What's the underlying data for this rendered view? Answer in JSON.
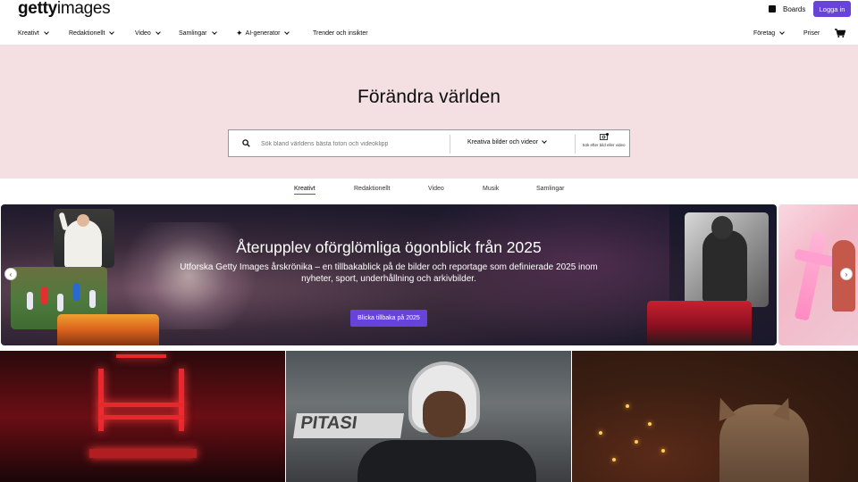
{
  "header": {
    "logo_bold": "getty",
    "logo_light": "images",
    "boards_label": "Boards",
    "login_label": "Logga in"
  },
  "nav": {
    "items": [
      {
        "label": "Kreativt"
      },
      {
        "label": "Redaktionellt"
      },
      {
        "label": "Video"
      },
      {
        "label": "Samlingar"
      },
      {
        "label": "AI-generator"
      },
      {
        "label": "Trender och insikter"
      }
    ],
    "right": [
      {
        "label": "Företag"
      },
      {
        "label": "Priser"
      }
    ]
  },
  "hero": {
    "title": "Förändra världen",
    "search_placeholder": "Sök bland världens bästa foton och videoklipp",
    "search_type": "Kreativa bilder och videor",
    "image_search_label": "Sök efter bild eller video"
  },
  "tabs": [
    {
      "label": "Kreativt",
      "active": true
    },
    {
      "label": "Redaktionellt",
      "active": false
    },
    {
      "label": "Video",
      "active": false
    },
    {
      "label": "Musik",
      "active": false
    },
    {
      "label": "Samlingar",
      "active": false
    }
  ],
  "banner": {
    "title": "Återupplev oförglömliga ögonblick från 2025",
    "subtitle": "Utforska Getty Images årskrönika – en tillbakablick på de bilder och reportage som definierade 2025 inom nyheter, sport, underhållning och arkivbilder.",
    "button_label": "Blicka tillbaka på 2025"
  },
  "colors": {
    "accent": "#6843da",
    "hero_bg": "#f4dfe3"
  }
}
